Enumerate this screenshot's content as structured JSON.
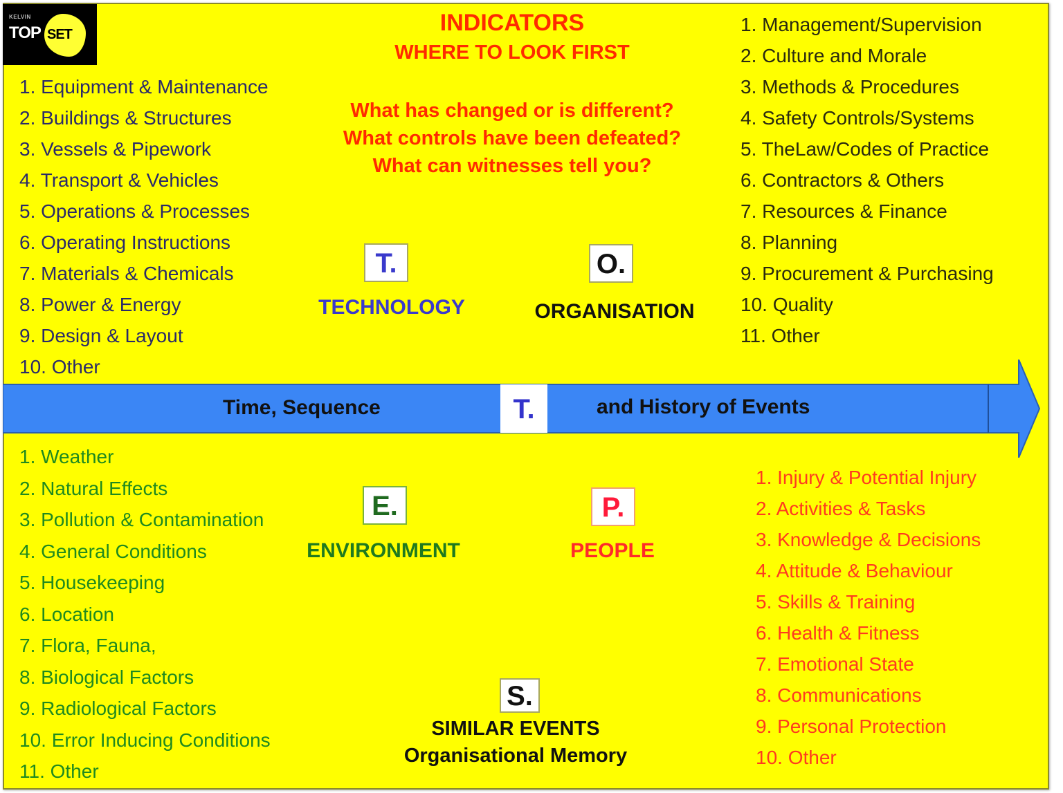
{
  "logo": {
    "small_text": "KELVIN",
    "word_1": "TOP",
    "word_2": "SET"
  },
  "header": {
    "title": "INDICATORS",
    "subtitle": "WHERE TO LOOK FIRST",
    "questions": [
      "What has changed or is different?",
      "What controls have been defeated?",
      "What can witnesses tell you?"
    ]
  },
  "colors": {
    "background": "#ffff00",
    "arrow": "#3b86f5",
    "technology": "#3a3acc",
    "organisation": "#111111",
    "environment": "#1f7a1f",
    "people": "#ff2a2a",
    "header_red": "#ff2a00"
  },
  "categories": {
    "technology": {
      "letter": "T.",
      "label": "TECHNOLOGY",
      "items": [
        "1. Equipment & Maintenance",
        "2. Buildings  & Structures",
        "3. Vessels & Pipework",
        "4. Transport & Vehicles",
        "5. Operations & Processes",
        "6. Operating Instructions",
        "7. Materials & Chemicals",
        "8. Power & Energy",
        "9. Design & Layout",
        "10. Other"
      ]
    },
    "organisation": {
      "letter": "O.",
      "label": "ORGANISATION",
      "items": [
        "1. Management/Supervision",
        "2. Culture and Morale",
        "3. Methods & Procedures",
        "4. Safety Controls/Systems",
        "5. TheLaw/Codes of Practice",
        "6. Contractors & Others",
        "7. Resources & Finance",
        "8. Planning",
        "9. Procurement & Purchasing",
        "10. Quality",
        "11. Other"
      ]
    },
    "environment": {
      "letter": "E.",
      "label": "ENVIRONMENT",
      "items": [
        "1. Weather",
        "2. Natural Effects",
        "3. Pollution  & Contamination",
        "4. General Conditions",
        "5. Housekeeping",
        "6. Location",
        "7. Flora, Fauna,",
        "8. Biological  Factors",
        "9. Radiological  Factors",
        "10. Error Inducing  Conditions",
        "11. Other"
      ]
    },
    "people": {
      "letter": "P.",
      "label": "PEOPLE",
      "items": [
        "1. Injury & Potential Injury",
        "2. Activities & Tasks",
        "3. Knowledge  & Decisions",
        "4. Attitude & Behaviour",
        "5. Skills  & Training",
        "6. Health & Fitness",
        "7. Emotional State",
        "8. Communications",
        "9. Personal Protection",
        "10. Other"
      ]
    }
  },
  "timeline": {
    "left_text": "Time, Sequence",
    "letter": "T.",
    "right_text": "and History of Events"
  },
  "similar_events": {
    "letter": "S.",
    "label": "SIMILAR EVENTS",
    "sublabel": "Organisational Memory"
  }
}
